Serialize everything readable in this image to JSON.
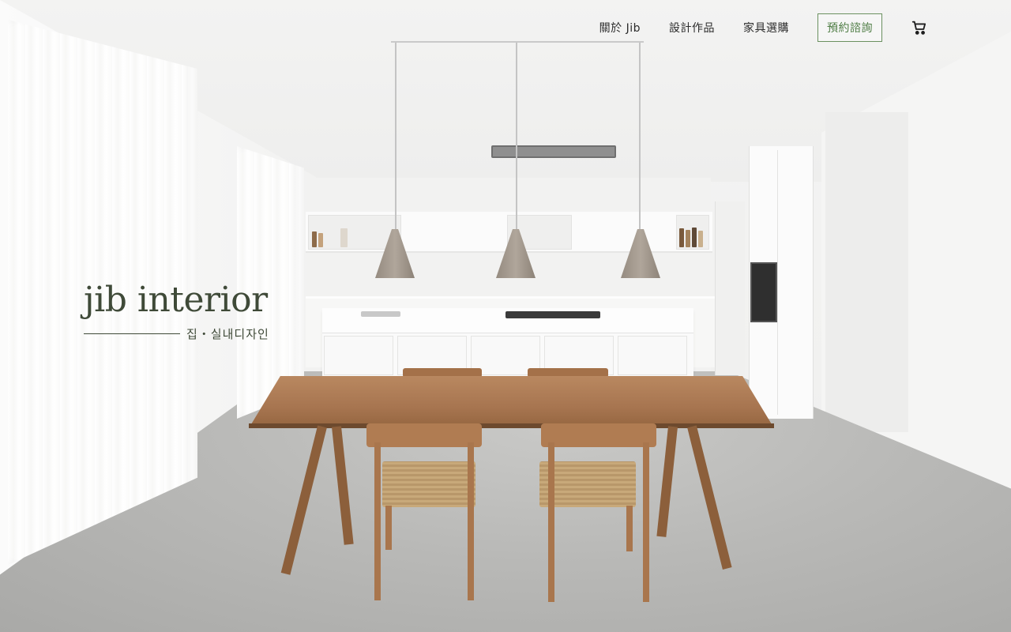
{
  "nav": {
    "items": [
      {
        "label": "關於 Jib"
      },
      {
        "label": "設計作品"
      },
      {
        "label": "家具選購"
      }
    ],
    "cta_label": "預約諮詢",
    "cart_icon": "shopping-cart-icon",
    "cta_color": "#6b9160"
  },
  "brand": {
    "title": "jib interior",
    "subtitle": "집・실내디자인",
    "color": "#3f4a38"
  },
  "hero": {
    "image": "hero-photo"
  }
}
